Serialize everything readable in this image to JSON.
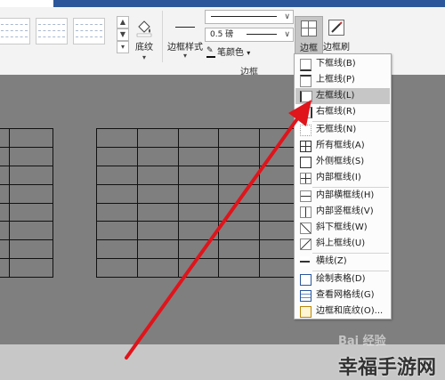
{
  "ribbon": {
    "shading_label": "底纹",
    "border_style_label": "边框样式",
    "line_weight_value": "0.5 磅",
    "pen_color_label": "笔颜色",
    "group_label": "边框",
    "borders_button_label": "边框",
    "border_painter_label": "边框刷"
  },
  "menu": {
    "items": [
      {
        "label": "下框线(B)",
        "icon": "bottom-border-icon"
      },
      {
        "label": "上框线(P)",
        "icon": "top-border-icon"
      },
      {
        "label": "左框线(L)",
        "icon": "left-border-icon",
        "highlighted": true
      },
      {
        "label": "右框线(R)",
        "icon": "right-border-icon"
      },
      {
        "label": "无框线(N)",
        "icon": "no-border-icon"
      },
      {
        "label": "所有框线(A)",
        "icon": "all-borders-icon"
      },
      {
        "label": "外侧框线(S)",
        "icon": "outside-borders-icon"
      },
      {
        "label": "内部框线(I)",
        "icon": "inside-borders-icon"
      },
      {
        "label": "内部横框线(H)",
        "icon": "inside-horizontal-border-icon"
      },
      {
        "label": "内部竖框线(V)",
        "icon": "inside-vertical-border-icon"
      },
      {
        "label": "斜下框线(W)",
        "icon": "diagonal-down-border-icon"
      },
      {
        "label": "斜上框线(U)",
        "icon": "diagonal-up-border-icon"
      },
      {
        "label": "横线(Z)",
        "icon": "horizontal-line-icon"
      },
      {
        "label": "绘制表格(D)",
        "icon": "draw-table-icon"
      },
      {
        "label": "查看网格线(G)",
        "icon": "view-gridlines-icon"
      },
      {
        "label": "边框和底纹(O)...",
        "icon": "borders-and-shading-icon"
      }
    ]
  },
  "watermark": "Bai 经验",
  "brand": "幸福手游网",
  "colors": {
    "arrow": "#e0141b",
    "title_bar": "#2b579a"
  }
}
